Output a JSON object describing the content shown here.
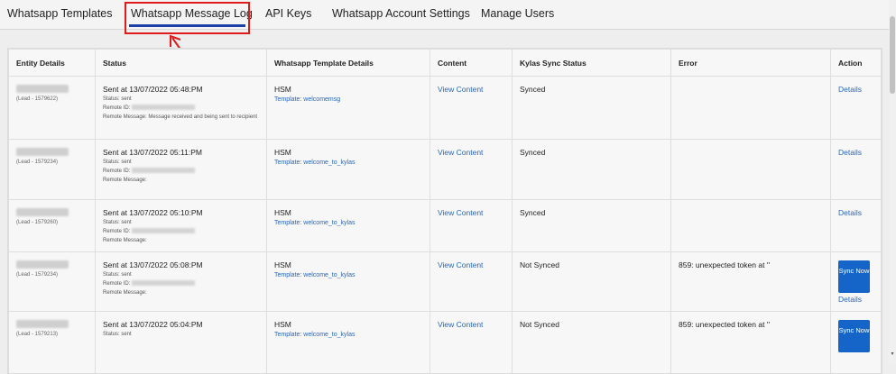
{
  "tabs": [
    {
      "label": "Whatsapp Templates"
    },
    {
      "label": "Whatsapp Message Log"
    },
    {
      "label": "API Keys"
    },
    {
      "label": "Whatsapp Account Settings"
    },
    {
      "label": "Manage Users"
    }
  ],
  "table": {
    "headers": [
      "Entity Details",
      "Status",
      "Whatsapp Template Details",
      "Content",
      "Kylas Sync Status",
      "Error",
      "Action"
    ],
    "rows": [
      {
        "lead": "(Lead - 1579622)",
        "sent": "Sent at 13/07/2022 05:48:PM",
        "status": "Status: sent",
        "remote_id": "Remote ID:",
        "remote_message": "Remote Message: Message received and being sent to recipient",
        "hsm": "HSM",
        "template": "Template: welcomemsg",
        "content": "View Content",
        "sync": "Synced",
        "error": "",
        "details": "Details"
      },
      {
        "lead": "(Lead - 1579234)",
        "sent": "Sent at 13/07/2022 05:11:PM",
        "status": "Status: sent",
        "remote_id": "Remote ID:",
        "remote_message": "Remote Message:",
        "hsm": "HSM",
        "template": "Template: welcome_to_kylas",
        "content": "View Content",
        "sync": "Synced",
        "error": "",
        "details": "Details"
      },
      {
        "lead": "(Lead - 1579260)",
        "sent": "Sent at 13/07/2022 05:10:PM",
        "status": "Status: sent",
        "remote_id": "Remote ID:",
        "remote_message": "Remote Message:",
        "hsm": "HSM",
        "template": "Template: welcome_to_kylas",
        "content": "View Content",
        "sync": "Synced",
        "error": "",
        "details": "Details"
      },
      {
        "lead": "(Lead - 1579234)",
        "sent": "Sent at 13/07/2022 05:08:PM",
        "status": "Status: sent",
        "remote_id": "Remote ID:",
        "remote_message": "Remote Message:",
        "hsm": "HSM",
        "template": "Template: welcome_to_kylas",
        "content": "View Content",
        "sync": "Not Synced",
        "error": "859: unexpected token at ''",
        "sync_button": "Sync Now",
        "details": "Details"
      },
      {
        "lead": "(Lead - 1579213)",
        "sent": "Sent at 13/07/2022 05:04:PM",
        "status": "Status: sent",
        "remote_id": "",
        "remote_message": "",
        "hsm": "HSM",
        "template": "Template: welcome_to_kylas",
        "content": "View Content",
        "sync": "Not Synced",
        "error": "859: unexpected token at ''",
        "sync_button": "Sync Now",
        "details": ""
      }
    ]
  },
  "colors": {
    "highlight": "#e01b1b",
    "link": "#2a67b8",
    "button": "#1565c8",
    "underline": "#1e3fa8"
  },
  "icons": {
    "annotation": "arrow-icon"
  }
}
